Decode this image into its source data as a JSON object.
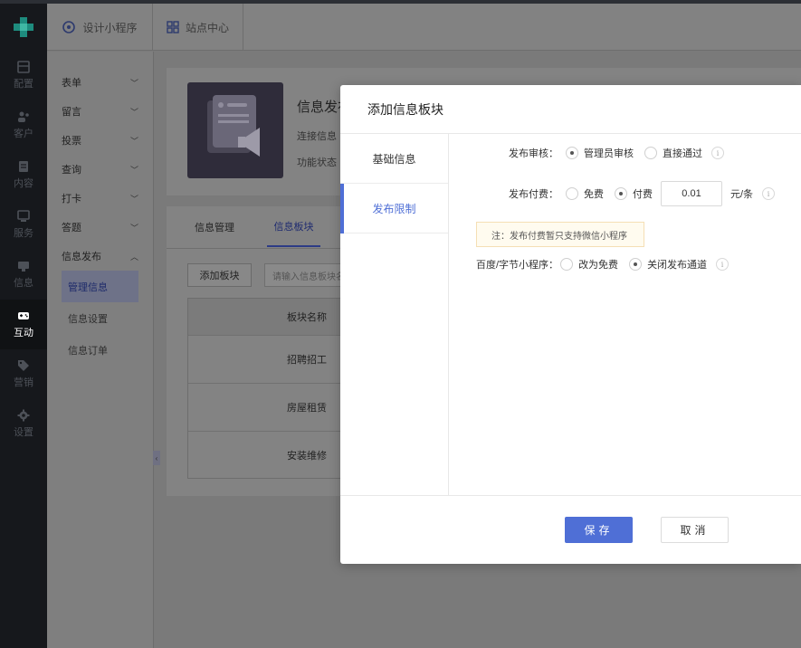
{
  "rail": {
    "items": [
      {
        "label": "配置",
        "icon": "config-icon"
      },
      {
        "label": "客户",
        "icon": "customer-icon"
      },
      {
        "label": "内容",
        "icon": "content-icon"
      },
      {
        "label": "服务",
        "icon": "service-icon"
      },
      {
        "label": "信息",
        "icon": "info-icon"
      },
      {
        "label": "互动",
        "icon": "gamepad-icon",
        "active": true
      },
      {
        "label": "营销",
        "icon": "tag-icon"
      },
      {
        "label": "设置",
        "icon": "gear-icon"
      }
    ]
  },
  "header": {
    "tab1": "设计小程序",
    "tab2": "站点中心"
  },
  "sidebar": {
    "groups": [
      "表单",
      "留言",
      "投票",
      "查询",
      "打卡",
      "答题",
      "信息发布"
    ],
    "children": [
      "管理信息",
      "信息设置",
      "信息订单"
    ]
  },
  "content": {
    "title": "信息发布",
    "line2": "连接信息",
    "line3": "功能状态"
  },
  "panel": {
    "tab1": "信息管理",
    "tab2": "信息板块",
    "add_button": "添加板块",
    "search_placeholder": "请输入信息板块名",
    "table_header": "板块名称",
    "rows": [
      "招聘招工",
      "房屋租赁",
      "安装维修"
    ]
  },
  "modal": {
    "title": "添加信息板块",
    "side_tabs": [
      "基础信息",
      "发布限制"
    ],
    "review_label": "发布审核：",
    "review_opt1": "管理员审核",
    "review_opt2": "直接通过",
    "fee_label": "发布付费：",
    "fee_opt1": "免费",
    "fee_opt2": "付费",
    "fee_amount": "0.01",
    "fee_unit": "元/条",
    "note": "注：发布付费暂只支持微信小程序",
    "baidu_label": "百度/字节小程序：",
    "baidu_opt1": "改为免费",
    "baidu_opt2": "关闭发布通道",
    "info_glyph": "i",
    "save": "保存",
    "cancel": "取消"
  },
  "colors": {
    "accent": "#4f6fd6",
    "rail_bg": "#16181c"
  }
}
